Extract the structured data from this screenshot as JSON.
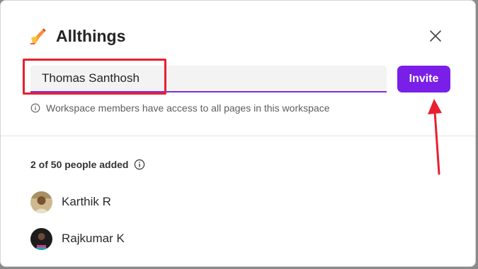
{
  "dialog": {
    "title": "Allthings",
    "workspace_icon": "writing-hand-emoji",
    "close_icon": "close-icon"
  },
  "invite": {
    "input_value": "Thomas Santhosh",
    "button_label": "Invite",
    "hint": "Workspace members have access to all pages in this workspace"
  },
  "members": {
    "count_label": "2 of 50 people added",
    "list": [
      {
        "name": "Karthik R"
      },
      {
        "name": "Rajkumar K"
      }
    ]
  },
  "colors": {
    "accent": "#7a1fe8",
    "annotation": "#e8202f"
  }
}
